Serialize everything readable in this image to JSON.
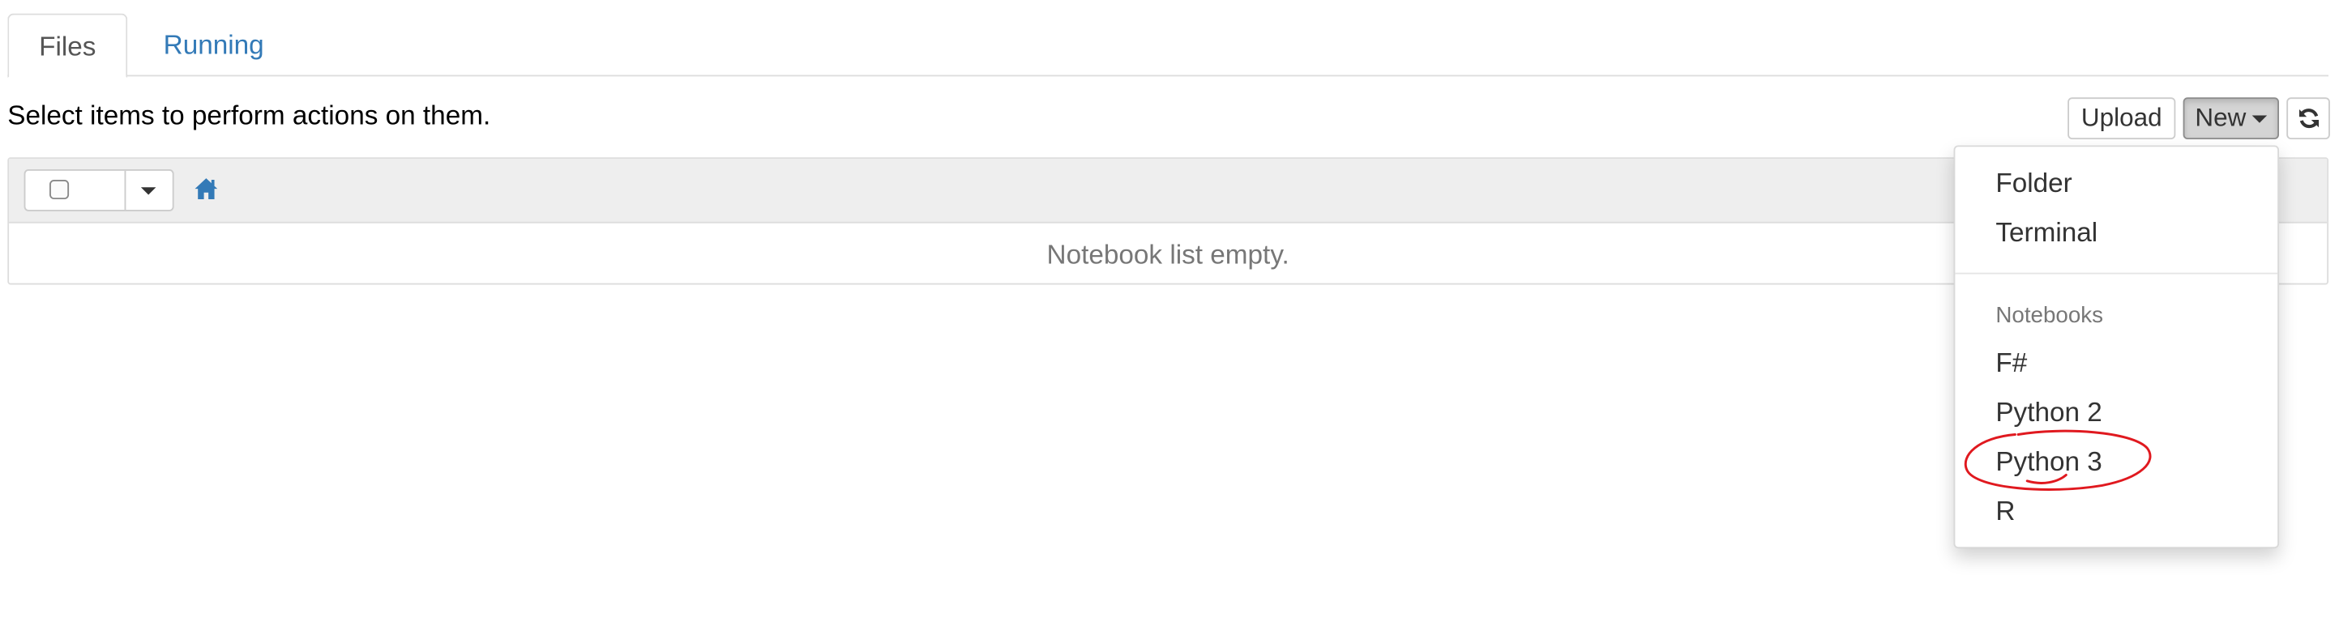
{
  "tabs": [
    {
      "label": "Files",
      "active": true
    },
    {
      "label": "Running",
      "active": false
    }
  ],
  "hint": "Select items to perform actions on them.",
  "toolbar": {
    "upload_label": "Upload",
    "new_label": "New",
    "refresh_icon": "refresh-icon"
  },
  "list": {
    "home_icon": "home-icon",
    "empty_message": "Notebook list empty."
  },
  "new_menu": {
    "items": [
      "Folder",
      "Terminal"
    ],
    "notebooks_header": "Notebooks",
    "notebooks": [
      "F#",
      "Python 2",
      "Python 3",
      "R"
    ],
    "highlighted": "Python 3"
  },
  "colors": {
    "link": "#337ab7",
    "annotation": "#e0191f",
    "panel_header": "#eeeeee"
  }
}
